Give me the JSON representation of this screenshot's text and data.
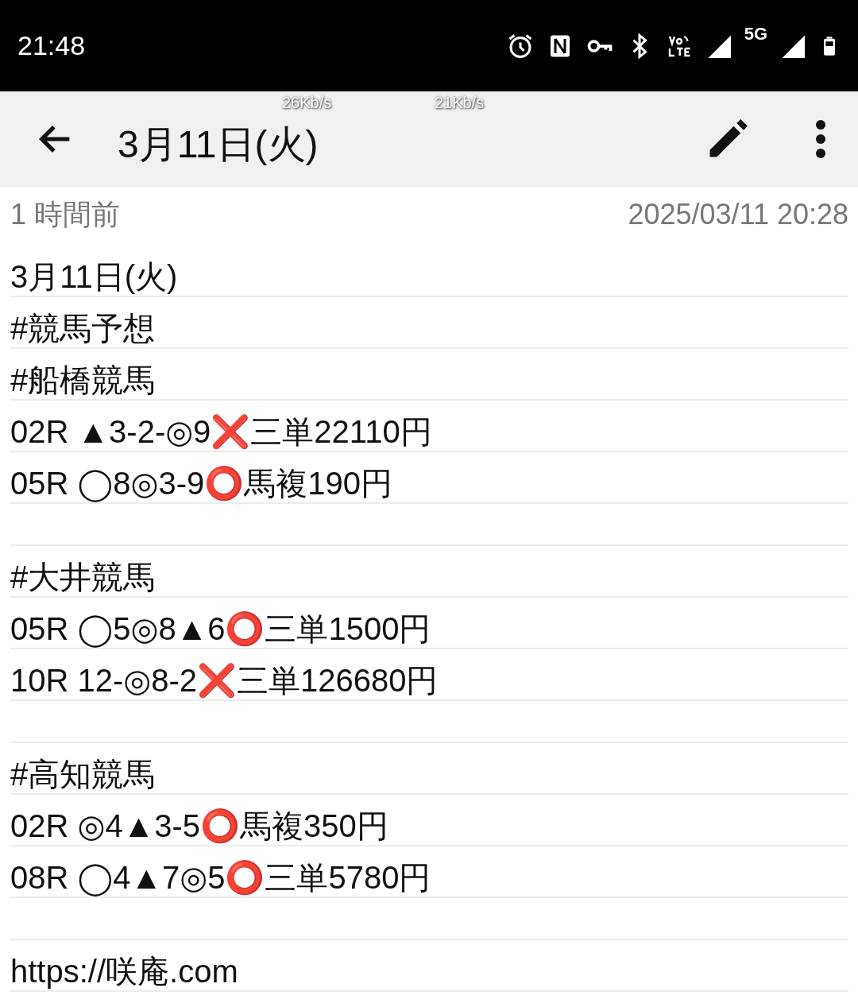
{
  "status_bar": {
    "time": "21:48",
    "network_label": "5G"
  },
  "app_bar": {
    "title": "3月11日(火)",
    "speed_overlays": [
      "26Kb/s",
      "21Kb/s"
    ]
  },
  "meta": {
    "relative_time": "1 時間前",
    "timestamp": "2025/03/11 20:28"
  },
  "note": {
    "groups": [
      {
        "lines": [
          "3月11日(火)",
          "#競馬予想",
          "#船橋競馬",
          "02R ▲3-2-◎9❌三単22110円",
          "05R ◯8◎3-9⭕馬複190円"
        ]
      },
      {
        "lines": [
          "#大井競馬",
          "05R ◯5◎8▲6⭕三単1500円",
          "10R 12-◎8-2❌三単126680円"
        ]
      },
      {
        "lines": [
          "#高知競馬",
          "02R ◎4▲3-5⭕馬複350円",
          "08R ◯4▲7◎5⭕三単5780円"
        ]
      },
      {
        "lines": [
          "https://咲庵.com"
        ]
      }
    ]
  }
}
